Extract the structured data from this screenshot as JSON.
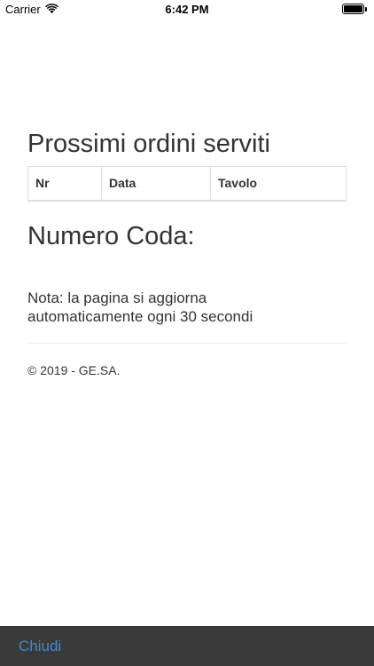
{
  "status_bar": {
    "carrier": "Carrier",
    "time": "6:42 PM"
  },
  "main": {
    "orders_title": "Prossimi ordini serviti",
    "table": {
      "headers": [
        "Nr",
        "Data",
        "Tavolo"
      ]
    },
    "queue_title": "Numero Coda:",
    "note_line1": "Nota: la pagina si aggiorna",
    "note_line2": "automaticamente ogni 30 secondi",
    "copyright": "© 2019 - GE.SA."
  },
  "toolbar": {
    "close_label": "Chiudi",
    "accent_color": "#3b8ad9",
    "background_color": "#3a3a3a"
  }
}
